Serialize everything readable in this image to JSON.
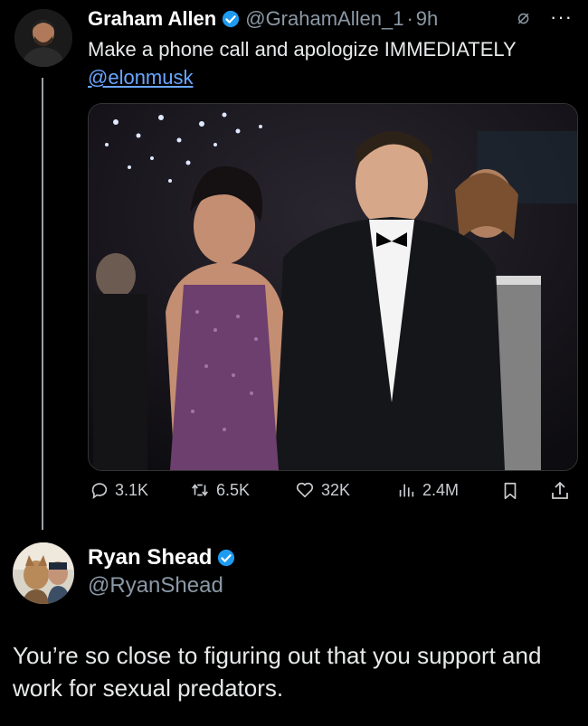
{
  "tweet": {
    "author_name": "Graham Allen",
    "author_handle": "@GrahamAllen_1",
    "separator": "·",
    "time": "9h",
    "text": "Make a phone call and apologize IMMEDIATELY",
    "mention": "@elonmusk",
    "image_description_icon": "photo-of-two-people-at-event",
    "stats": {
      "replies": "3.1K",
      "retweets": "6.5K",
      "likes": "32K",
      "views": "2.4M"
    }
  },
  "reply": {
    "author_name": "Ryan Shead",
    "author_handle": "@RyanShead",
    "text": "You’re so close to figuring out that you support and work for sexual predators."
  },
  "colors": {
    "background": "#000000",
    "text": "#e7e9ea",
    "secondary": "#8b98a5",
    "link": "#6aa6ff",
    "verified": "#1d9bf0"
  }
}
